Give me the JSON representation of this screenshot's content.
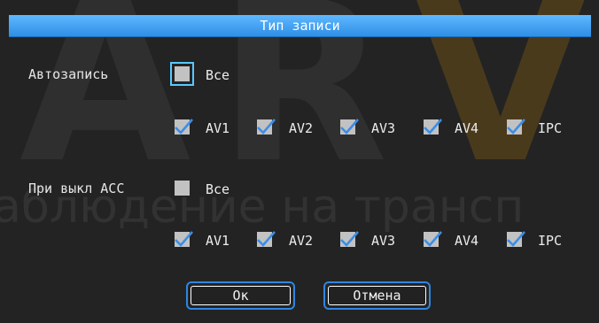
{
  "dialog": {
    "title": "Тип записи"
  },
  "watermark": {
    "big": "ARVI",
    "small": "аблюдение на трансп"
  },
  "autorecord": {
    "label": "Автозапись",
    "all_label": "Все",
    "all_checked": false,
    "channels": [
      {
        "label": "AV1",
        "checked": true
      },
      {
        "label": "AV2",
        "checked": true
      },
      {
        "label": "AV3",
        "checked": true
      },
      {
        "label": "AV4",
        "checked": true
      },
      {
        "label": "IPC",
        "checked": true
      }
    ]
  },
  "acc_off": {
    "label": "При выкл ACC",
    "all_label": "Все",
    "all_checked": false,
    "channels": [
      {
        "label": "AV1",
        "checked": true
      },
      {
        "label": "AV2",
        "checked": true
      },
      {
        "label": "AV3",
        "checked": true
      },
      {
        "label": "AV4",
        "checked": true
      },
      {
        "label": "IPC",
        "checked": true
      }
    ]
  },
  "buttons": {
    "ok": "Ок",
    "cancel": "Отмена"
  },
  "colors": {
    "title_bar": "#2f8fe6",
    "checkmark": "#3a8ee8",
    "focus": "#58c8ff",
    "button_border": "#2f86e0"
  }
}
